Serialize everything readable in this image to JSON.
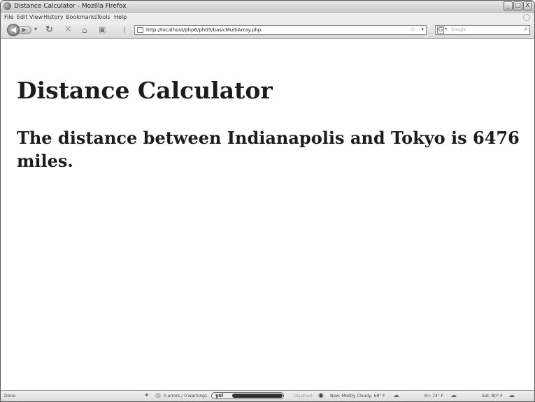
{
  "window": {
    "title": "Distance Calculator - Mozilla Firefox",
    "controls": [
      "_",
      "□",
      "X"
    ]
  },
  "menu": [
    "File",
    "Edit",
    "View",
    "History",
    "Bookmarks",
    "Tools",
    "Help"
  ],
  "nav": {
    "url": "http://localhost/php6/ph05/basicMultiArray.php",
    "search_placeholder": "Google",
    "search_engine_letter": "G"
  },
  "page": {
    "heading": "Distance Calculator",
    "result": "The distance between Indianapolis and Tokyo is 6476 miles."
  },
  "status": {
    "left": "Done",
    "validator": "0 errors / 0 warnings",
    "yslow_label": "ysl",
    "disabled": "Disabled",
    "weather_now": "Now: Mostly Cloudy, 68° F",
    "weather_fri": "Fri: 74° F",
    "weather_sat": "Sat: 80° F"
  }
}
